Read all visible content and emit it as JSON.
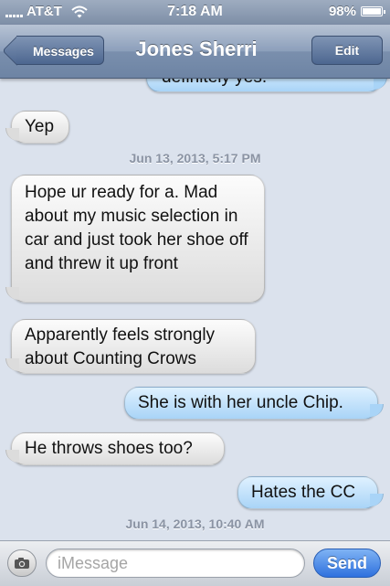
{
  "status_bar": {
    "carrier": "AT&T",
    "time": "7:18 AM",
    "battery": "98%",
    "battery_level": 0.98,
    "icons": [
      "signal-icon",
      "wifi-icon",
      "battery-icon"
    ]
  },
  "nav": {
    "back_label": "Messages",
    "title": "Jones Sherri",
    "edit_label": "Edit"
  },
  "conversation": {
    "partial_sent": "definitely yes.",
    "messages": [
      {
        "type": "received",
        "text": "Yep"
      },
      {
        "type": "timestamp",
        "text": "Jun 13, 2013, 5:17 PM"
      },
      {
        "type": "received",
        "text": "Hope ur ready for a.  Mad about my music selection in car and just took her shoe off and threw it up front"
      },
      {
        "type": "received",
        "text": "Apparently feels strongly about Counting Crows"
      },
      {
        "type": "sent",
        "text": "She is with her uncle Chip."
      },
      {
        "type": "received",
        "text": "He throws shoes too?"
      },
      {
        "type": "sent",
        "text": "Hates the CC"
      },
      {
        "type": "timestamp",
        "text": "Jun 14, 2013, 10:40 AM"
      }
    ]
  },
  "composer": {
    "placeholder": "iMessage",
    "send_label": "Send",
    "camera_icon": "camera-icon"
  },
  "colors": {
    "background": "#dbe2ed",
    "sent_bubble": "#a9d4f7",
    "received_bubble": "#dcdcdc",
    "send_button": "#2f71de"
  }
}
